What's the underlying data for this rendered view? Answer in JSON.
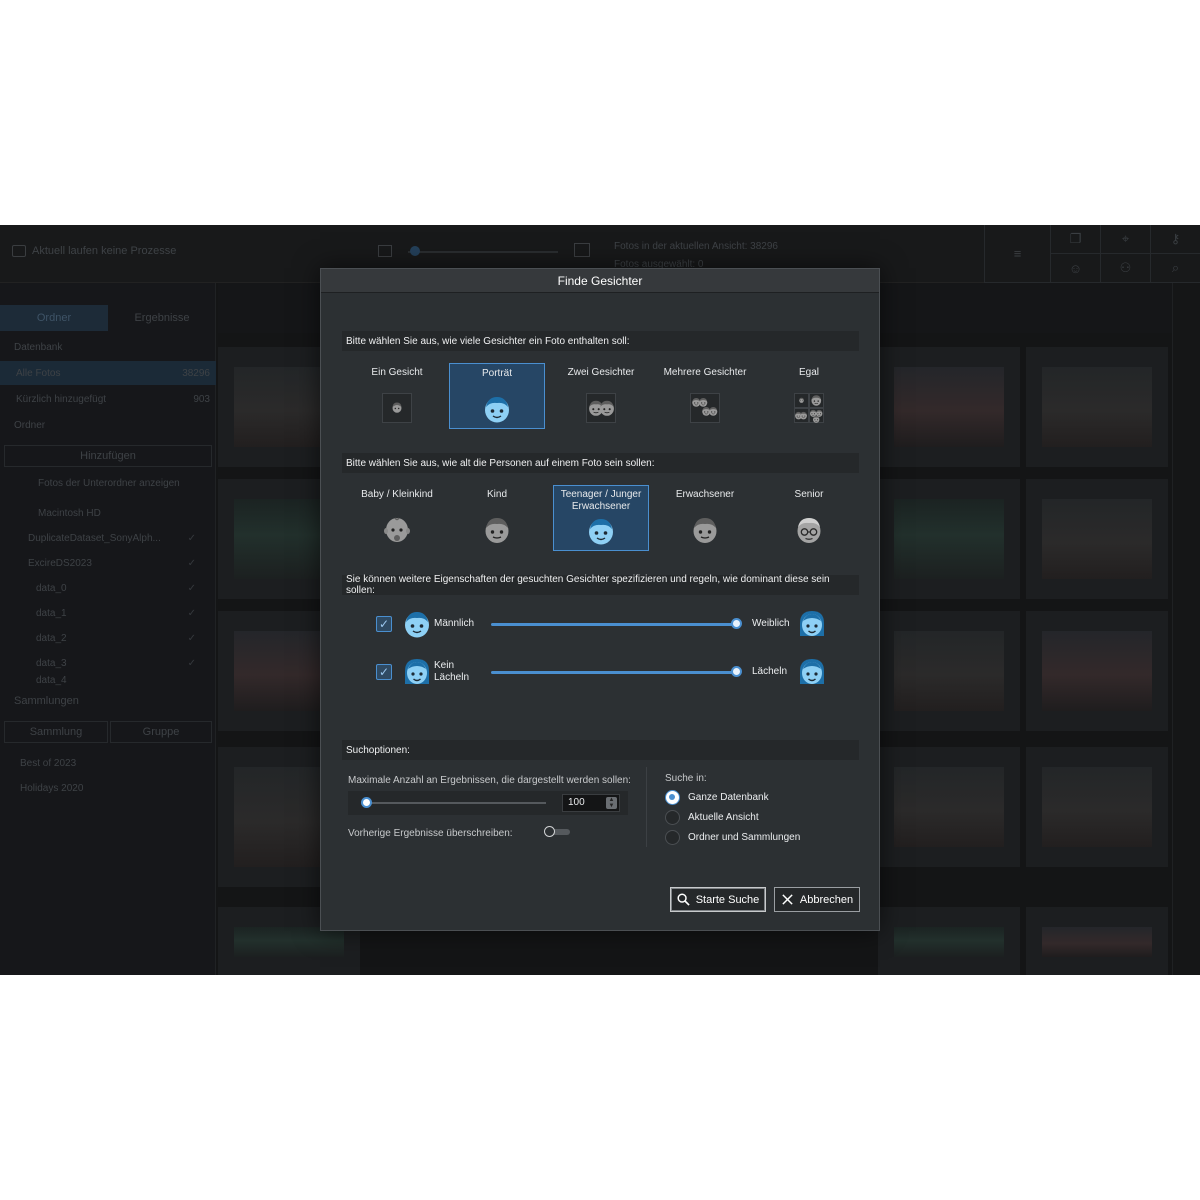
{
  "background_app": {
    "status_text": "Aktuell laufen keine Prozesse",
    "view_info": "Fotos in der aktuellen Ansicht: 38296",
    "selected_info": "Fotos ausgewählt: 0",
    "tabs": [
      "Ordner",
      "Ergebnisse"
    ],
    "database_header": "Datenbank",
    "all_photos": {
      "label": "Alle Fotos",
      "count": "38296"
    },
    "recent": {
      "label": "Kürzlich hinzugefügt",
      "count": "903"
    },
    "folder_header": "Ordner",
    "add_button": "Hinzufügen",
    "show_subfolders": "Fotos der Unterordner anzeigen",
    "volume": "Macintosh HD",
    "folders": [
      "DuplicateDataset_SonyAlph...",
      "ExcireDS2023",
      "data_0",
      "data_1",
      "data_2",
      "data_3",
      "data_4"
    ],
    "collections_header": "Sammlungen",
    "collection_button": "Sammlung",
    "group_button": "Gruppe",
    "collections": [
      "Best of 2023",
      "Holidays 2020"
    ]
  },
  "dialog": {
    "title": "Finde Gesichter",
    "section_count": "Bitte wählen Sie aus, wie viele Gesichter ein Foto enthalten soll:",
    "count_options": [
      {
        "label": "Ein Gesicht",
        "icon": "single-small-face-icon",
        "selected": false
      },
      {
        "label": "Porträt",
        "icon": "portrait-face-icon",
        "selected": true
      },
      {
        "label": "Zwei Gesichter",
        "icon": "two-faces-icon",
        "selected": false
      },
      {
        "label": "Mehrere Gesichter",
        "icon": "multiple-faces-icon",
        "selected": false
      },
      {
        "label": "Egal",
        "icon": "any-faces-icon",
        "selected": false
      }
    ],
    "section_age": "Bitte wählen Sie aus, wie alt die Personen auf einem Foto sein sollen:",
    "age_options": [
      {
        "label": "Baby / Kleinkind",
        "icon": "baby-face-icon",
        "selected": false
      },
      {
        "label": "Kind",
        "icon": "child-face-icon",
        "selected": false
      },
      {
        "label": "Teenager / Junger Erwachsener",
        "icon": "teen-face-icon",
        "selected": true
      },
      {
        "label": "Erwachsener",
        "icon": "adult-face-icon",
        "selected": false
      },
      {
        "label": "Senior",
        "icon": "senior-face-icon",
        "selected": false
      }
    ],
    "section_attributes": "Sie können weitere Eigenschaften der gesuchten Gesichter spezifizieren und regeln, wie dominant diese sein sollen:",
    "attributes": [
      {
        "left_label": "Männlich",
        "right_label": "Weiblich",
        "checked": true,
        "value": 1.0
      },
      {
        "left_label": "Kein Lächeln",
        "right_label": "Lächeln",
        "checked": true,
        "value": 1.0
      }
    ],
    "section_options": "Suchoptionen:",
    "max_results_label": "Maximale Anzahl an Ergebnissen, die dargestellt werden sollen:",
    "max_results_value": "100",
    "overwrite_label": "Vorherige Ergebnisse überschreiben:",
    "overwrite_on": false,
    "search_in_label": "Suche in:",
    "search_in_options": [
      {
        "label": "Ganze Datenbank",
        "selected": true
      },
      {
        "label": "Aktuelle Ansicht",
        "selected": false
      },
      {
        "label": "Ordner und Sammlungen",
        "selected": false
      }
    ],
    "start_button": "Starte Suche",
    "cancel_button": "Abbrechen"
  },
  "colors": {
    "accent": "#4a8fd0",
    "selected_bg": "#264665",
    "dialog_bg": "#2c3033",
    "face_blue": "#8ed0f5",
    "face_gray": "#9a9a9a"
  }
}
